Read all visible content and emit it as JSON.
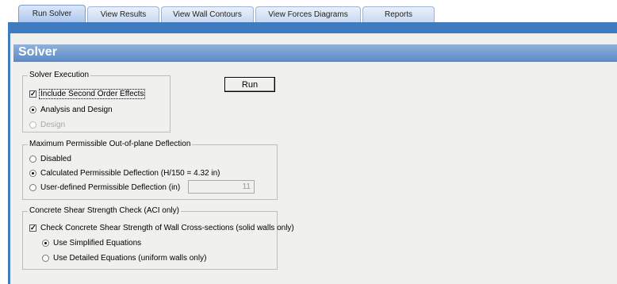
{
  "tabs": [
    {
      "label": "Run Solver",
      "active": true
    },
    {
      "label": "View Results",
      "active": false
    },
    {
      "label": "View Wall Contours",
      "active": false
    },
    {
      "label": "View Forces Diagrams",
      "active": false
    },
    {
      "label": "Reports",
      "active": false
    }
  ],
  "header": {
    "title": "Solver"
  },
  "run_button": {
    "label": "Run"
  },
  "solver_execution": {
    "legend": "Solver Execution",
    "second_order": {
      "label": "Include Second Order Effects",
      "checked": true
    },
    "analysis_design": {
      "label": "Analysis and Design",
      "selected": true
    },
    "design": {
      "label": "Design",
      "selected": false,
      "disabled": true
    }
  },
  "deflection": {
    "legend": "Maximum Permissible Out-of-plane Deflection",
    "disabled_opt": {
      "label": "Disabled",
      "selected": false
    },
    "calculated": {
      "label": "Calculated Permissible Deflection (H/150 = 4.32 in)",
      "selected": true
    },
    "user_defined": {
      "label": "User-defined Permissible Deflection (in)",
      "selected": false
    },
    "user_value": "11"
  },
  "shear": {
    "legend": "Concrete Shear Strength Check (ACI only)",
    "check": {
      "label": "Check Concrete Shear Strength of Wall Cross-sections (solid walls only)",
      "checked": true
    },
    "simplified": {
      "label": "Use Simplified Equations",
      "selected": true
    },
    "detailed": {
      "label": "Use Detailed Equations (uniform walls only)",
      "selected": false
    }
  },
  "colors": {
    "frame": "#3e7bc1",
    "panel": "#f0f0ee",
    "header_band": "#6b96cc"
  }
}
